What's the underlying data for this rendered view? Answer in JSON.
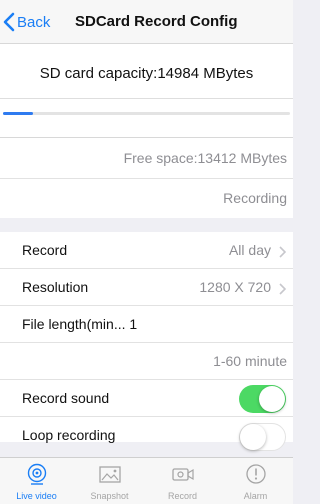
{
  "nav": {
    "back_label": "Back",
    "title": "SDCard Record Config"
  },
  "capacity": {
    "text": "SD card capacity:14984 MBytes",
    "used_fraction": 0.105
  },
  "info": {
    "free_space": "Free space:13412 MBytes",
    "status": "Recording"
  },
  "settings": {
    "record": {
      "label": "Record",
      "value": "All day"
    },
    "resolution": {
      "label": "Resolution",
      "value": "1280 X 720"
    },
    "file_length": {
      "label": "File length(min... 1",
      "hint": "1-60 minute"
    },
    "record_sound": {
      "label": "Record sound",
      "on": true
    },
    "loop_recording": {
      "label": "Loop recording",
      "on": false
    }
  },
  "tabs": [
    {
      "label": "Live video",
      "icon": "live-video-icon",
      "active": true
    },
    {
      "label": "Snapshot",
      "icon": "snapshot-icon",
      "active": false
    },
    {
      "label": "Record",
      "icon": "record-icon",
      "active": false
    },
    {
      "label": "Alarm",
      "icon": "alarm-icon",
      "active": false
    }
  ],
  "colors": {
    "accent": "#1a7ef5",
    "toggle_on": "#4cd964",
    "progress": "#2f7bf0"
  }
}
